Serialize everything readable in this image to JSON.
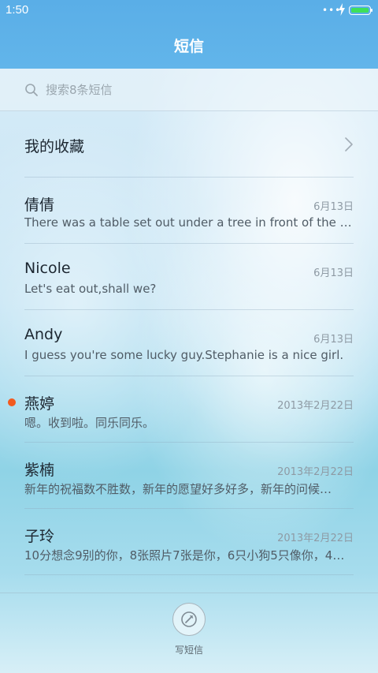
{
  "status_bar": {
    "time": "1:50",
    "signal_dots": "•••"
  },
  "header": {
    "title": "短信"
  },
  "search": {
    "placeholder": "搜索8条短信"
  },
  "favorites": {
    "label": "我的收藏"
  },
  "messages": [
    {
      "name": "倩倩",
      "date": "6月13日",
      "preview": "There was a table set out under a tree in front of the ho…",
      "unread": false
    },
    {
      "name": "Nicole",
      "date": "6月13日",
      "preview": "Let's eat out,shall we?",
      "unread": false
    },
    {
      "name": "Andy",
      "date": "6月13日",
      "preview": "I guess you're some lucky guy.Stephanie is a nice girl.",
      "unread": false
    },
    {
      "name": "燕婷",
      "date": "2013年2月22日",
      "preview": "嗯。收到啦。同乐同乐。",
      "unread": true
    },
    {
      "name": "紫楠",
      "date": "2013年2月22日",
      "preview": "新年的祝福数不胜数，新年的愿望好多好多，新年的问候…",
      "unread": false
    },
    {
      "name": "子玲",
      "date": "2013年2月22日",
      "preview": "10分想念9别的你，8张照片7张是你，6只小狗5只像你，4…",
      "unread": false
    }
  ],
  "compose": {
    "label": "写短信"
  },
  "colors": {
    "header": "#5aaee7",
    "unread_dot": "#f25a1f",
    "battery": "#3ee05a"
  }
}
